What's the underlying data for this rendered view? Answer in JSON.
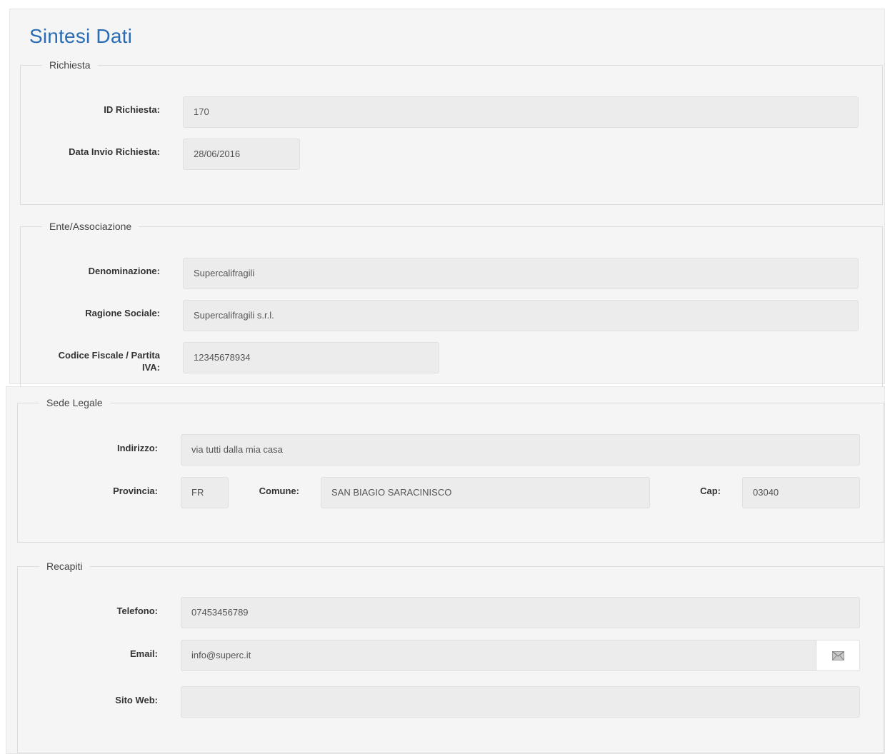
{
  "page": {
    "title": "Sintesi Dati"
  },
  "richiesta": {
    "legend": "Richiesta",
    "id_label": "ID Richiesta:",
    "id_value": "170",
    "data_label": "Data Invio Richiesta:",
    "data_value": "28/06/2016"
  },
  "ente": {
    "legend": "Ente/Associazione",
    "denominazione_label": "Denominazione:",
    "denominazione_value": "Supercalifragili",
    "ragione_label": "Ragione Sociale:",
    "ragione_value": "Supercalifragili s.r.l.",
    "cf_label_line1": "Codice Fiscale / Partita",
    "cf_label_line2": "IVA:",
    "cf_value": "12345678934"
  },
  "sede": {
    "legend": "Sede Legale",
    "indirizzo_label": "Indirizzo:",
    "indirizzo_value": "via tutti dalla mia casa",
    "provincia_label": "Provincia:",
    "provincia_value": "FR",
    "comune_label": "Comune:",
    "comune_value": "SAN BIAGIO SARACINISCO",
    "cap_label": "Cap:",
    "cap_value": "03040"
  },
  "recapiti": {
    "legend": "Recapiti",
    "telefono_label": "Telefono:",
    "telefono_value": "07453456789",
    "email_label": "Email:",
    "email_value": "info@superc.it",
    "email_icon": "envelope-icon",
    "sito_label": "Sito Web:",
    "sito_value": ""
  },
  "colors": {
    "title": "#2a6db5",
    "panel": "#f5f5f5",
    "field": "#ececec"
  }
}
